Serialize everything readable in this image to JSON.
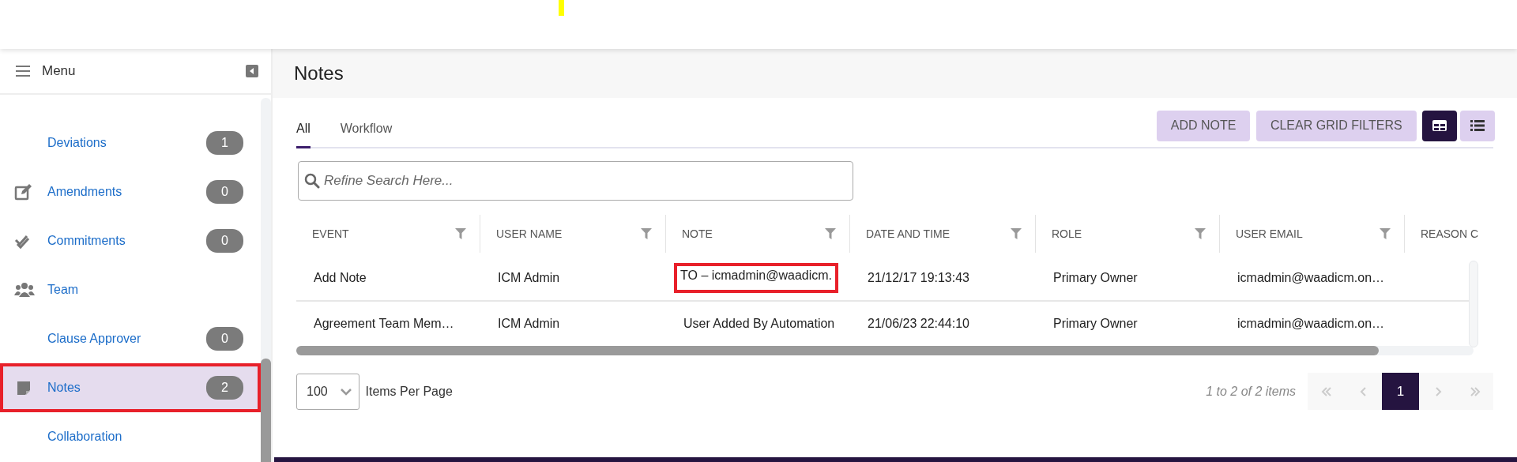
{
  "sidebar": {
    "title": "Menu",
    "items": [
      {
        "label": "Deviations",
        "kind": "none",
        "count": "1",
        "selected": false,
        "outlined": false
      },
      {
        "label": "Amendments",
        "kind": "edit",
        "count": "0",
        "selected": false,
        "outlined": false
      },
      {
        "label": "Commitments",
        "kind": "checks",
        "count": "0",
        "selected": false,
        "outlined": false
      },
      {
        "label": "Team",
        "kind": "team",
        "selected": false,
        "outlined": false
      },
      {
        "label": "Clause Approver",
        "kind": "none",
        "count": "0",
        "selected": false,
        "outlined": false
      },
      {
        "label": "Notes",
        "kind": "note",
        "count": "2",
        "selected": true,
        "outlined": true
      },
      {
        "label": "Collaboration",
        "kind": "none",
        "selected": false,
        "outlined": false
      }
    ]
  },
  "page_title": "Notes",
  "tabs": [
    {
      "label": "All",
      "selected": true
    },
    {
      "label": "Workflow",
      "selected": false
    }
  ],
  "buttons": [
    "ADD NOTE",
    "CLEAR GRID FILTERS"
  ],
  "view_toggles": [
    {
      "kind": "grid",
      "selected": true
    },
    {
      "kind": "list",
      "selected": false
    }
  ],
  "search": {
    "placeholder": "Refine Search Here..."
  },
  "table": {
    "columns": [
      {
        "label": "EVENT",
        "filter": true
      },
      {
        "label": "USER NAME",
        "filter": true
      },
      {
        "label": "NOTE",
        "filter": true
      },
      {
        "label": "DATE AND TIME",
        "filter": true
      },
      {
        "label": "ROLE",
        "filter": true
      },
      {
        "label": "USER EMAIL",
        "filter": true
      },
      {
        "label": "REASON C"
      }
    ],
    "rows": [
      {
        "cells": [
          {
            "text": "Add Note",
            "outlined": false
          },
          {
            "text": "ICM Admin",
            "outlined": false
          },
          {
            "text": "TO – icmadmin@waadicm.",
            "outlined": true
          },
          {
            "text": "21/12/17 19:13:43",
            "outlined": false
          },
          {
            "text": "Primary Owner",
            "outlined": false
          },
          {
            "text": "icmadmin@waadicm.on…",
            "outlined": false
          }
        ]
      },
      {
        "cells": [
          {
            "text": "Agreement Team Mem…",
            "outlined": false
          },
          {
            "text": "ICM Admin",
            "outlined": false
          },
          {
            "text": "User Added By Automation",
            "outlined": false
          },
          {
            "text": "21/06/23 22:44:10",
            "outlined": false
          },
          {
            "text": "Primary Owner",
            "outlined": false
          },
          {
            "text": "icmadmin@waadicm.on…",
            "outlined": false
          }
        ]
      }
    ]
  },
  "pager": {
    "page_size": "100",
    "page_size_label": "Items Per Page",
    "summary": "1 to 2 of 2 items",
    "pages": [
      {
        "label": "1",
        "selected": true
      }
    ]
  }
}
